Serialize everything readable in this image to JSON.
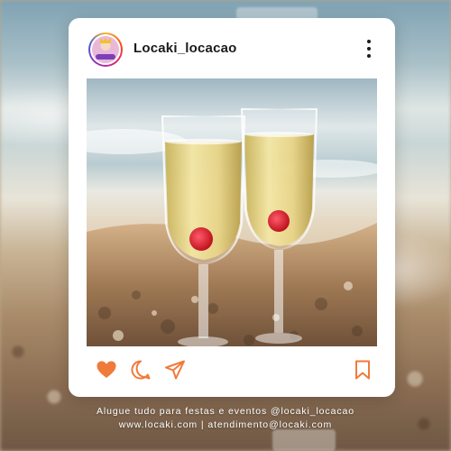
{
  "post": {
    "username": "Locaki_locacao",
    "avatar_icon": "locaki-logo-icon",
    "more_icon": "more-vertical-icon",
    "photo_icon": "champagne-glasses-image"
  },
  "actions": {
    "like_icon": "heart-icon",
    "comment_icon": "comment-icon",
    "share_icon": "send-icon",
    "save_icon": "bookmark-icon",
    "like_color": "#f07a3a",
    "outline_color": "#f07a3a"
  },
  "footer": {
    "line1": "Alugue tudo para festas e eventos @locaki_locacao",
    "line2": "www.locaki.com | atendimento@locaki.com"
  }
}
